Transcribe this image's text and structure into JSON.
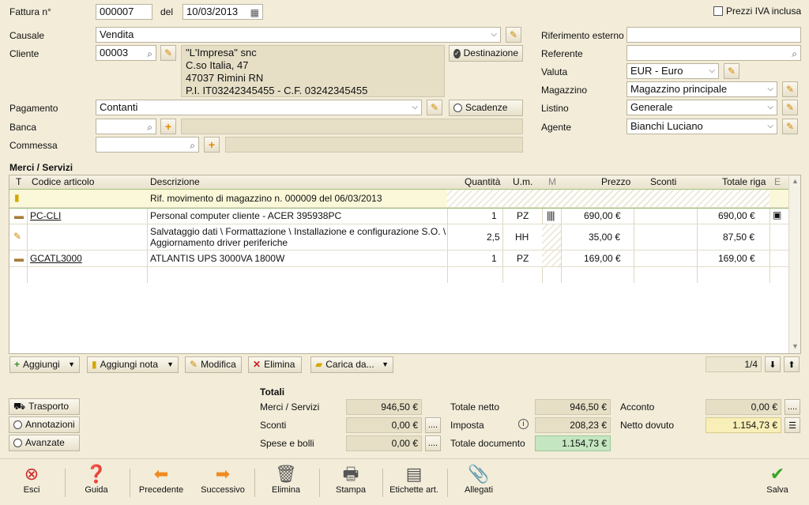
{
  "header": {
    "fattura_label": "Fattura n°",
    "fattura_number": "000007",
    "del_label": "del",
    "date": "10/03/2013",
    "prezzi_iva_label": "Prezzi IVA inclusa"
  },
  "form": {
    "causale_label": "Causale",
    "causale_value": "Vendita",
    "cliente_label": "Cliente",
    "cliente_code": "00003",
    "address_lines": [
      "\"L'Impresa\" snc",
      "C.so Italia, 47",
      "47037 Rimini RN",
      "P.I. IT03242345455 - C.F. 03242345455"
    ],
    "destinazione_label": "Destinazione",
    "pagamento_label": "Pagamento",
    "pagamento_value": "Contanti",
    "scadenze_label": "Scadenze",
    "banca_label": "Banca",
    "commessa_label": "Commessa",
    "rif_esterno_label": "Riferimento esterno",
    "referente_label": "Referente",
    "valuta_label": "Valuta",
    "valuta_value": "EUR - Euro",
    "magazzino_label": "Magazzino",
    "magazzino_value": "Magazzino principale",
    "listino_label": "Listino",
    "listino_value": "Generale",
    "agente_label": "Agente",
    "agente_value": "Bianchi Luciano"
  },
  "grid": {
    "section_title": "Merci / Servizi",
    "columns": [
      "T",
      "Codice articolo",
      "Descrizione",
      "Quantità",
      "U.m.",
      "M",
      "Prezzo",
      "Sconti",
      "Totale riga",
      "E"
    ],
    "rows": [
      {
        "code": "",
        "desc1": "Rif. movimento di magazzino n. 000009 del 06/03/2013",
        "desc2": "",
        "qty": "",
        "um": "",
        "price": "",
        "total": ""
      },
      {
        "code": "PC-CLI",
        "desc1": "Personal computer cliente - ACER 395938PC",
        "desc2": "",
        "qty": "1",
        "um": "PZ",
        "price": "690,00 €",
        "total": "690,00 €"
      },
      {
        "code": "",
        "desc1": "Salvataggio dati \\ Formattazione \\ Installazione e configurazione S.O. \\",
        "desc2": "Aggiornamento driver periferiche",
        "qty": "2,5",
        "um": "HH",
        "price": "35,00 €",
        "total": "87,50 €"
      },
      {
        "code": "GCATL3000",
        "desc1": "ATLANTIS UPS 3000VA 1800W",
        "desc2": "",
        "qty": "1",
        "um": "PZ",
        "price": "169,00 €",
        "total": "169,00 €"
      }
    ],
    "toolbar": {
      "aggiungi": "Aggiungi",
      "aggiungi_nota": "Aggiungi nota",
      "modifica": "Modifica",
      "elimina": "Elimina",
      "carica_da": "Carica da...",
      "pager": "1/4"
    }
  },
  "totals": {
    "title": "Totali",
    "trasporto": "Trasporto",
    "annotazioni": "Annotazioni",
    "avanzate": "Avanzate",
    "merci_label": "Merci / Servizi",
    "merci_value": "946,50 €",
    "sconti_label": "Sconti",
    "sconti_value": "0,00 €",
    "spese_label": "Spese e bolli",
    "spese_value": "0,00 €",
    "netto_label": "Totale netto",
    "netto_value": "946,50 €",
    "imposta_label": "Imposta",
    "imposta_value": "208,23 €",
    "documento_label": "Totale documento",
    "documento_value": "1.154,73 €",
    "acconto_label": "Acconto",
    "acconto_value": "0,00 €",
    "dovuto_label": "Netto dovuto",
    "dovuto_value": "1.154,73 €",
    "dots": "...."
  },
  "bottom_toolbar": [
    "Esci",
    "Guida",
    "Precedente",
    "Successivo",
    "Elimina",
    "Stampa",
    "Etichette art.",
    "Allegati",
    "Salva"
  ],
  "colors": {
    "background": "#f2ecd9",
    "highlight_green": "#c4e6c0",
    "highlight_yellow": "#f8efb8"
  }
}
